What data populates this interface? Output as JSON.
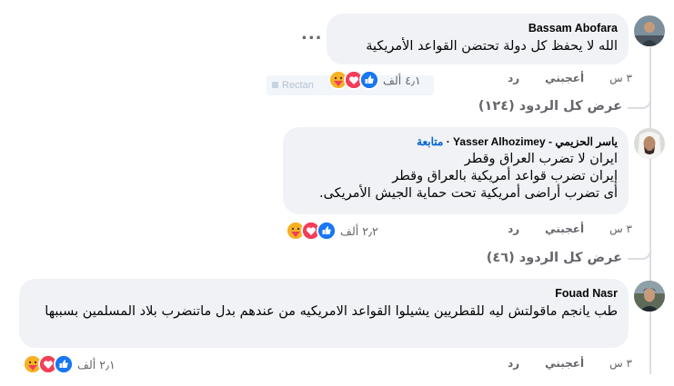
{
  "comments": [
    {
      "author": "Bassam Abofara",
      "text": "الله لا يحفظ كل دولة تحتضن القواعد الأمريكية",
      "time": "٣ س",
      "like_label": "أعجبني",
      "reply_label": "رد",
      "reaction_count": "٤٫١ ألف",
      "more_label": "...",
      "view_replies": "عرض كل الردود (١٢٤)"
    },
    {
      "author_ar": "ياسر الحزيمي",
      "author_en": "Yasser Alhozimey",
      "author_sep": "-",
      "follow_dot": "·",
      "follow_label": "متابعة",
      "text": "ايران لا تضرب العراق وقطر\nإيران تضرب قواعد أمريكية بالعراق وقطر\nأى تضرب أراضى أمريكية تحت حماية الجيش الأمريكى.",
      "time": "٣ س",
      "like_label": "أعجبني",
      "reply_label": "رد",
      "reaction_count": "٢٫٢ ألف",
      "view_replies": "عرض كل الردود (٤٦)"
    },
    {
      "author": "Fouad Nasr",
      "text": "طب يانجم ماقولتش ليه للقطريين يشيلوا القواعد الامريكيه من عندهم بدل ماتنضرب بلاد المسلمين بسببها",
      "time": "٣ س",
      "like_label": "أعجبني",
      "reply_label": "رد",
      "reaction_count": "٢٫١ ألف"
    }
  ],
  "tooltip_text": "Rectan",
  "colors": {
    "like": "#1877f2",
    "love": "#f33e58",
    "care": "#f7b125",
    "bubble": "#f0f2f5",
    "meta": "#65676b",
    "follow": "#0064d1"
  }
}
